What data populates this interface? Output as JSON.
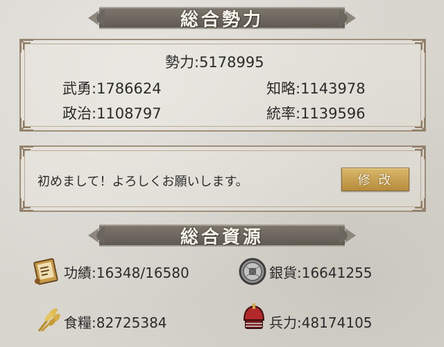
{
  "sections": {
    "power_title": "総合勢力",
    "resources_title": "総合資源"
  },
  "power": {
    "total": "勢力:5178995",
    "bravery": "武勇:1786624",
    "intellect": "知略:1143978",
    "politics": "政治:1108797",
    "leadership": "統率:1139596"
  },
  "profile": {
    "greeting": "初めまして！よろしくお願いします。",
    "edit_label": "修 改"
  },
  "resources": {
    "merit": "功績:16348/16580",
    "silver": "銀貨:16641255",
    "food": "食糧:82725384",
    "troops": "兵力:48174105"
  },
  "icons": {
    "merit": "scroll-icon",
    "silver": "coin-icon",
    "food": "grain-icon",
    "troops": "helmet-icon"
  },
  "colors": {
    "banner": "#6b665e",
    "button": "#c9a352",
    "frame": "#a08f7a"
  }
}
